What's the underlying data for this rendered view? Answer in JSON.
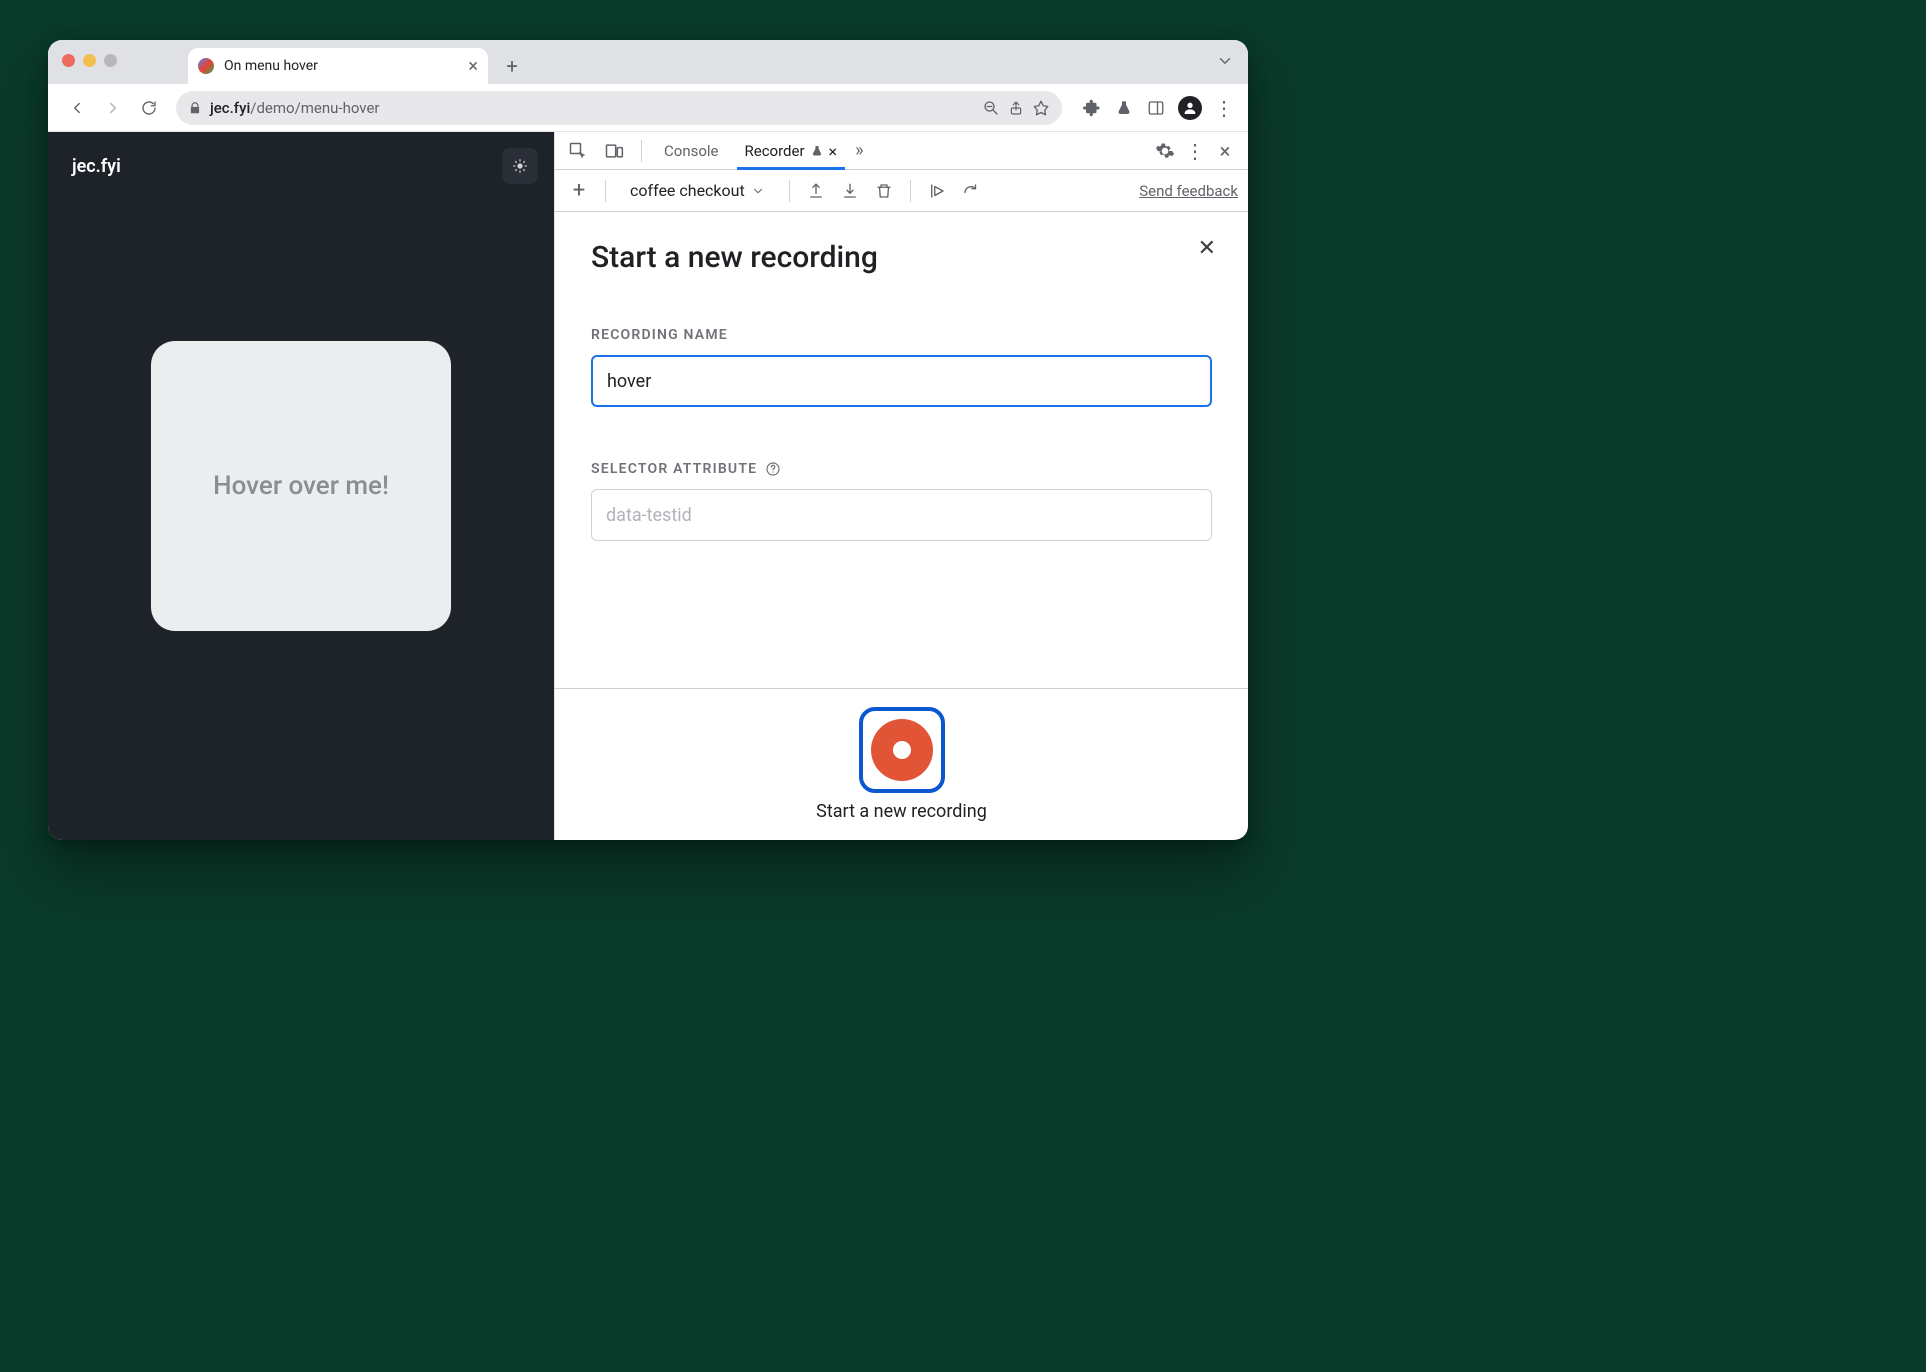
{
  "browser": {
    "tab_title": "On menu hover",
    "url_host": "jec.fyi",
    "url_path": "/demo/menu-hover"
  },
  "page": {
    "brand": "jec.fyi",
    "card_text": "Hover over me!"
  },
  "devtools": {
    "tabs": {
      "console": "Console",
      "recorder": "Recorder"
    },
    "toolbar": {
      "recording_select": "coffee checkout",
      "feedback": "Send feedback"
    },
    "panel": {
      "title": "Start a new recording",
      "recording_name_label": "RECORDING NAME",
      "recording_name_value": "hover",
      "selector_attr_label": "SELECTOR ATTRIBUTE",
      "selector_attr_placeholder": "data-testid",
      "start_button_label": "Start a new recording"
    }
  }
}
